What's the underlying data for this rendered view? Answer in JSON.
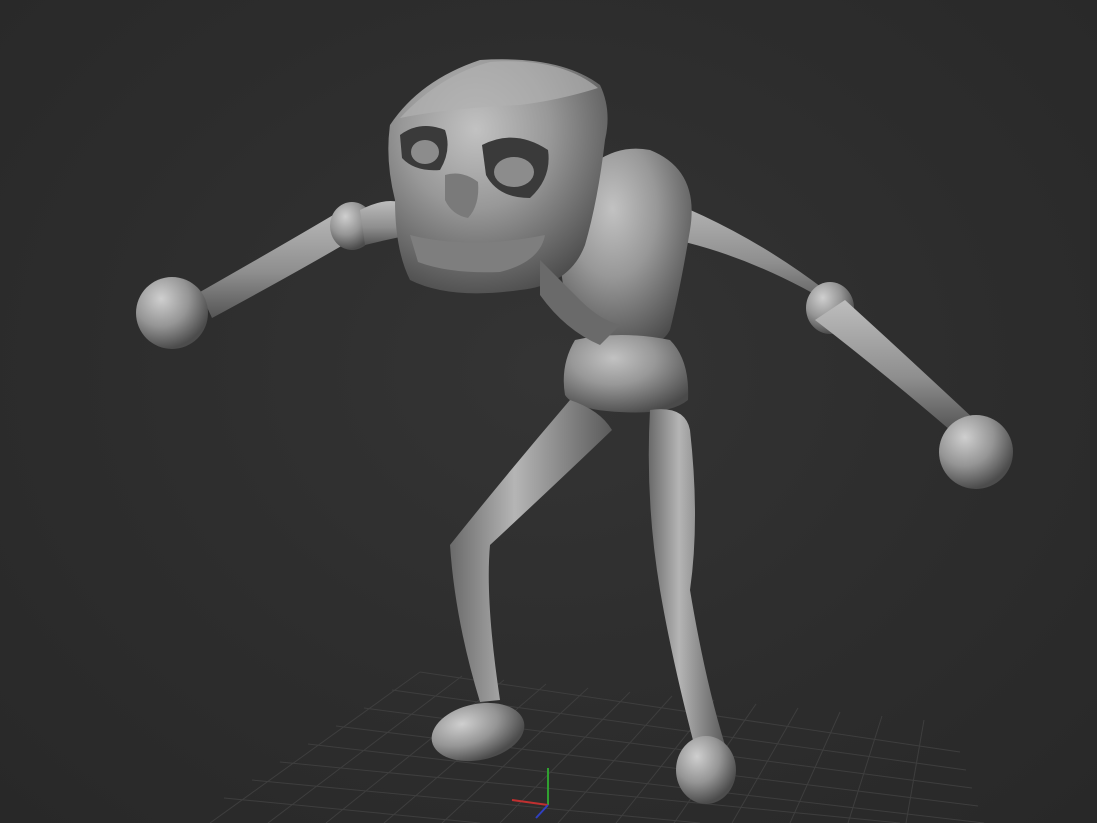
{
  "viewport": {
    "background_color": "#2b2b2b",
    "model_color": "#9a9a9a",
    "grid_color": "#3e3e3e"
  },
  "model": {
    "name_icon": "sculpt-figure-icon"
  },
  "gizmo": {
    "x_axis_color": "#c03030",
    "y_axis_color": "#30a030",
    "z_axis_color": "#3040c0"
  }
}
